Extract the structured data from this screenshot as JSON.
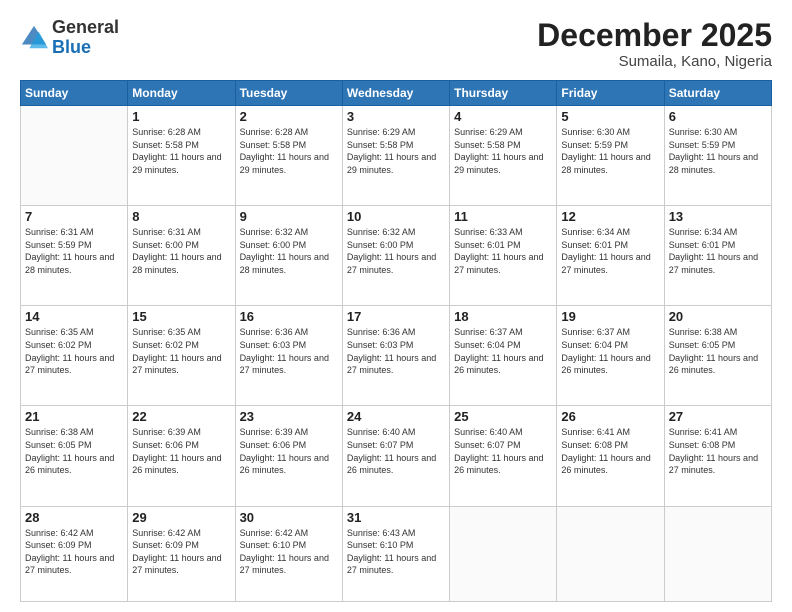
{
  "logo": {
    "general": "General",
    "blue": "Blue"
  },
  "header": {
    "month": "December 2025",
    "location": "Sumaila, Kano, Nigeria"
  },
  "weekdays": [
    "Sunday",
    "Monday",
    "Tuesday",
    "Wednesday",
    "Thursday",
    "Friday",
    "Saturday"
  ],
  "weeks": [
    [
      {
        "day": "",
        "sunrise": "",
        "sunset": "",
        "daylight": ""
      },
      {
        "day": "1",
        "sunrise": "Sunrise: 6:28 AM",
        "sunset": "Sunset: 5:58 PM",
        "daylight": "Daylight: 11 hours and 29 minutes."
      },
      {
        "day": "2",
        "sunrise": "Sunrise: 6:28 AM",
        "sunset": "Sunset: 5:58 PM",
        "daylight": "Daylight: 11 hours and 29 minutes."
      },
      {
        "day": "3",
        "sunrise": "Sunrise: 6:29 AM",
        "sunset": "Sunset: 5:58 PM",
        "daylight": "Daylight: 11 hours and 29 minutes."
      },
      {
        "day": "4",
        "sunrise": "Sunrise: 6:29 AM",
        "sunset": "Sunset: 5:58 PM",
        "daylight": "Daylight: 11 hours and 29 minutes."
      },
      {
        "day": "5",
        "sunrise": "Sunrise: 6:30 AM",
        "sunset": "Sunset: 5:59 PM",
        "daylight": "Daylight: 11 hours and 28 minutes."
      },
      {
        "day": "6",
        "sunrise": "Sunrise: 6:30 AM",
        "sunset": "Sunset: 5:59 PM",
        "daylight": "Daylight: 11 hours and 28 minutes."
      }
    ],
    [
      {
        "day": "7",
        "sunrise": "Sunrise: 6:31 AM",
        "sunset": "Sunset: 5:59 PM",
        "daylight": "Daylight: 11 hours and 28 minutes."
      },
      {
        "day": "8",
        "sunrise": "Sunrise: 6:31 AM",
        "sunset": "Sunset: 6:00 PM",
        "daylight": "Daylight: 11 hours and 28 minutes."
      },
      {
        "day": "9",
        "sunrise": "Sunrise: 6:32 AM",
        "sunset": "Sunset: 6:00 PM",
        "daylight": "Daylight: 11 hours and 28 minutes."
      },
      {
        "day": "10",
        "sunrise": "Sunrise: 6:32 AM",
        "sunset": "Sunset: 6:00 PM",
        "daylight": "Daylight: 11 hours and 27 minutes."
      },
      {
        "day": "11",
        "sunrise": "Sunrise: 6:33 AM",
        "sunset": "Sunset: 6:01 PM",
        "daylight": "Daylight: 11 hours and 27 minutes."
      },
      {
        "day": "12",
        "sunrise": "Sunrise: 6:34 AM",
        "sunset": "Sunset: 6:01 PM",
        "daylight": "Daylight: 11 hours and 27 minutes."
      },
      {
        "day": "13",
        "sunrise": "Sunrise: 6:34 AM",
        "sunset": "Sunset: 6:01 PM",
        "daylight": "Daylight: 11 hours and 27 minutes."
      }
    ],
    [
      {
        "day": "14",
        "sunrise": "Sunrise: 6:35 AM",
        "sunset": "Sunset: 6:02 PM",
        "daylight": "Daylight: 11 hours and 27 minutes."
      },
      {
        "day": "15",
        "sunrise": "Sunrise: 6:35 AM",
        "sunset": "Sunset: 6:02 PM",
        "daylight": "Daylight: 11 hours and 27 minutes."
      },
      {
        "day": "16",
        "sunrise": "Sunrise: 6:36 AM",
        "sunset": "Sunset: 6:03 PM",
        "daylight": "Daylight: 11 hours and 27 minutes."
      },
      {
        "day": "17",
        "sunrise": "Sunrise: 6:36 AM",
        "sunset": "Sunset: 6:03 PM",
        "daylight": "Daylight: 11 hours and 27 minutes."
      },
      {
        "day": "18",
        "sunrise": "Sunrise: 6:37 AM",
        "sunset": "Sunset: 6:04 PM",
        "daylight": "Daylight: 11 hours and 26 minutes."
      },
      {
        "day": "19",
        "sunrise": "Sunrise: 6:37 AM",
        "sunset": "Sunset: 6:04 PM",
        "daylight": "Daylight: 11 hours and 26 minutes."
      },
      {
        "day": "20",
        "sunrise": "Sunrise: 6:38 AM",
        "sunset": "Sunset: 6:05 PM",
        "daylight": "Daylight: 11 hours and 26 minutes."
      }
    ],
    [
      {
        "day": "21",
        "sunrise": "Sunrise: 6:38 AM",
        "sunset": "Sunset: 6:05 PM",
        "daylight": "Daylight: 11 hours and 26 minutes."
      },
      {
        "day": "22",
        "sunrise": "Sunrise: 6:39 AM",
        "sunset": "Sunset: 6:06 PM",
        "daylight": "Daylight: 11 hours and 26 minutes."
      },
      {
        "day": "23",
        "sunrise": "Sunrise: 6:39 AM",
        "sunset": "Sunset: 6:06 PM",
        "daylight": "Daylight: 11 hours and 26 minutes."
      },
      {
        "day": "24",
        "sunrise": "Sunrise: 6:40 AM",
        "sunset": "Sunset: 6:07 PM",
        "daylight": "Daylight: 11 hours and 26 minutes."
      },
      {
        "day": "25",
        "sunrise": "Sunrise: 6:40 AM",
        "sunset": "Sunset: 6:07 PM",
        "daylight": "Daylight: 11 hours and 26 minutes."
      },
      {
        "day": "26",
        "sunrise": "Sunrise: 6:41 AM",
        "sunset": "Sunset: 6:08 PM",
        "daylight": "Daylight: 11 hours and 26 minutes."
      },
      {
        "day": "27",
        "sunrise": "Sunrise: 6:41 AM",
        "sunset": "Sunset: 6:08 PM",
        "daylight": "Daylight: 11 hours and 27 minutes."
      }
    ],
    [
      {
        "day": "28",
        "sunrise": "Sunrise: 6:42 AM",
        "sunset": "Sunset: 6:09 PM",
        "daylight": "Daylight: 11 hours and 27 minutes."
      },
      {
        "day": "29",
        "sunrise": "Sunrise: 6:42 AM",
        "sunset": "Sunset: 6:09 PM",
        "daylight": "Daylight: 11 hours and 27 minutes."
      },
      {
        "day": "30",
        "sunrise": "Sunrise: 6:42 AM",
        "sunset": "Sunset: 6:10 PM",
        "daylight": "Daylight: 11 hours and 27 minutes."
      },
      {
        "day": "31",
        "sunrise": "Sunrise: 6:43 AM",
        "sunset": "Sunset: 6:10 PM",
        "daylight": "Daylight: 11 hours and 27 minutes."
      },
      {
        "day": "",
        "sunrise": "",
        "sunset": "",
        "daylight": ""
      },
      {
        "day": "",
        "sunrise": "",
        "sunset": "",
        "daylight": ""
      },
      {
        "day": "",
        "sunrise": "",
        "sunset": "",
        "daylight": ""
      }
    ]
  ]
}
